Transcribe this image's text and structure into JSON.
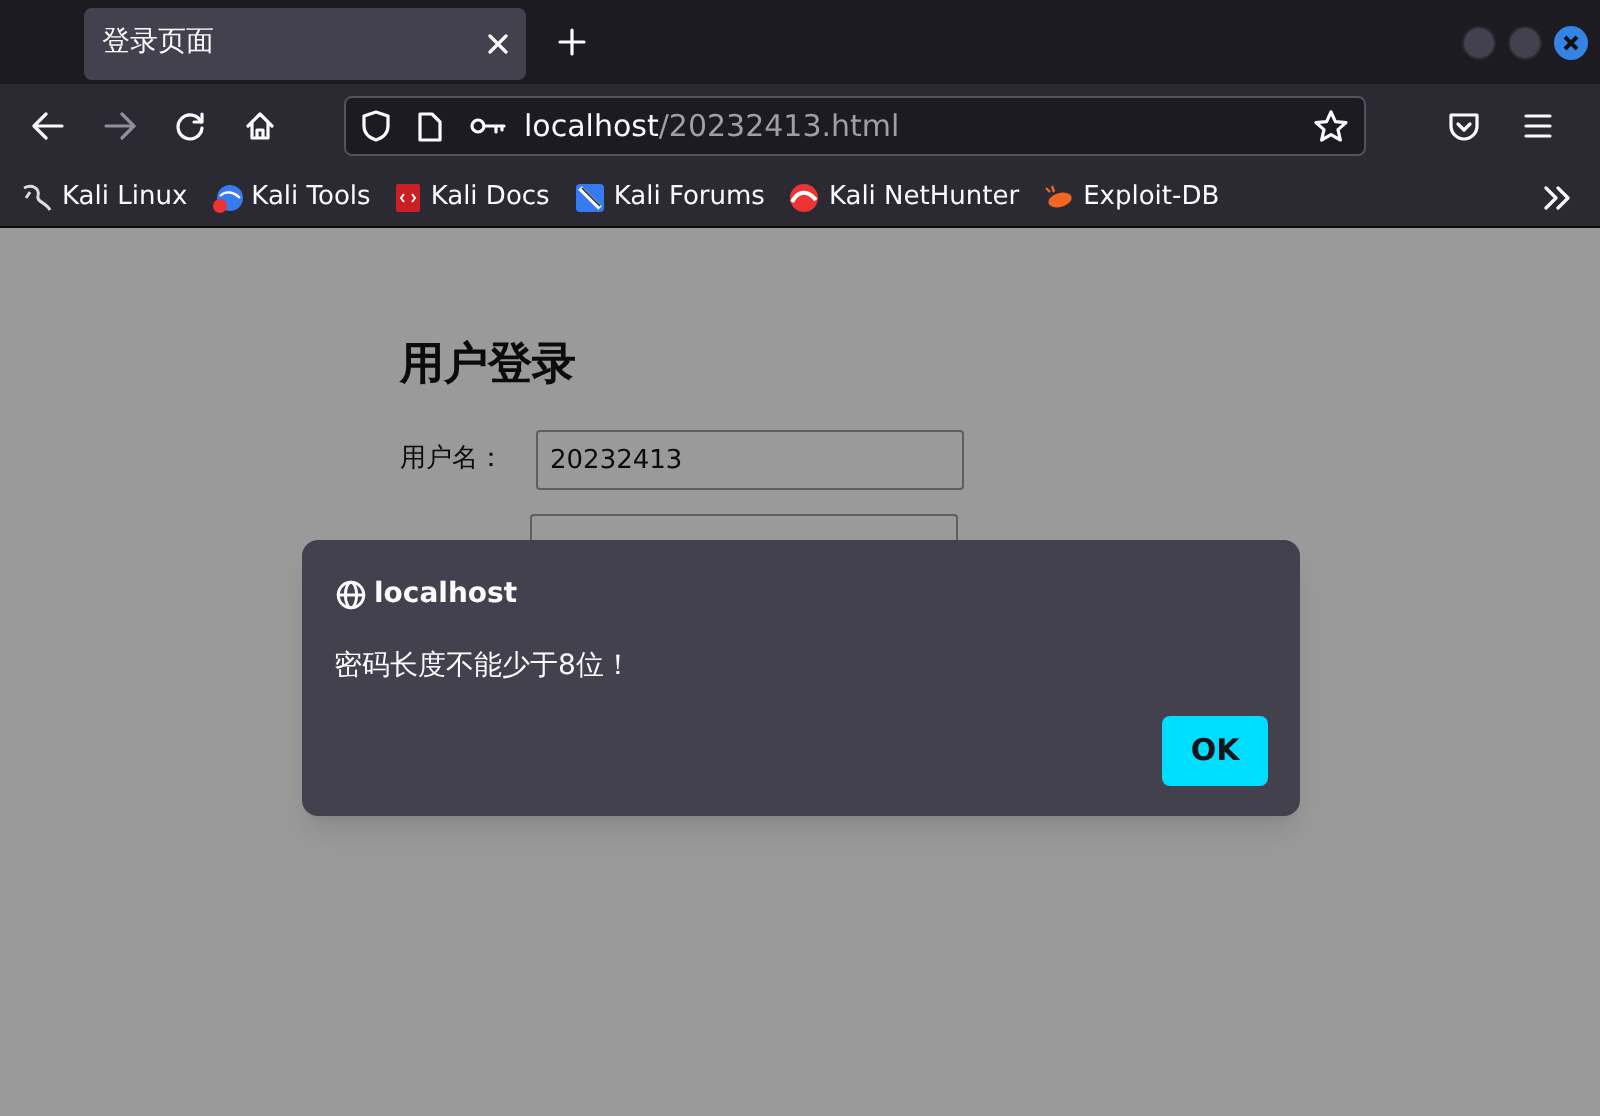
{
  "tab": {
    "title": "登录页面",
    "selected": true
  },
  "address": {
    "host": "localhost",
    "path": "/20232413.html"
  },
  "bookmarks": [
    {
      "label": "Kali Linux",
      "kind": "dragon"
    },
    {
      "label": "Kali Tools",
      "kind": "tools"
    },
    {
      "label": "Kali Docs",
      "kind": "docs"
    },
    {
      "label": "Kali Forums",
      "kind": "forums"
    },
    {
      "label": "Kali NetHunter",
      "kind": "nethunter"
    },
    {
      "label": "Exploit-DB",
      "kind": "bug"
    }
  ],
  "page": {
    "heading": "用户登录",
    "fields": [
      {
        "label": "用户名：",
        "value": "20232413"
      },
      {
        "kind": "covered"
      }
    ]
  },
  "dialog": {
    "origin": "localhost",
    "message": "密码长度不能少于8位！",
    "button": "OK"
  }
}
